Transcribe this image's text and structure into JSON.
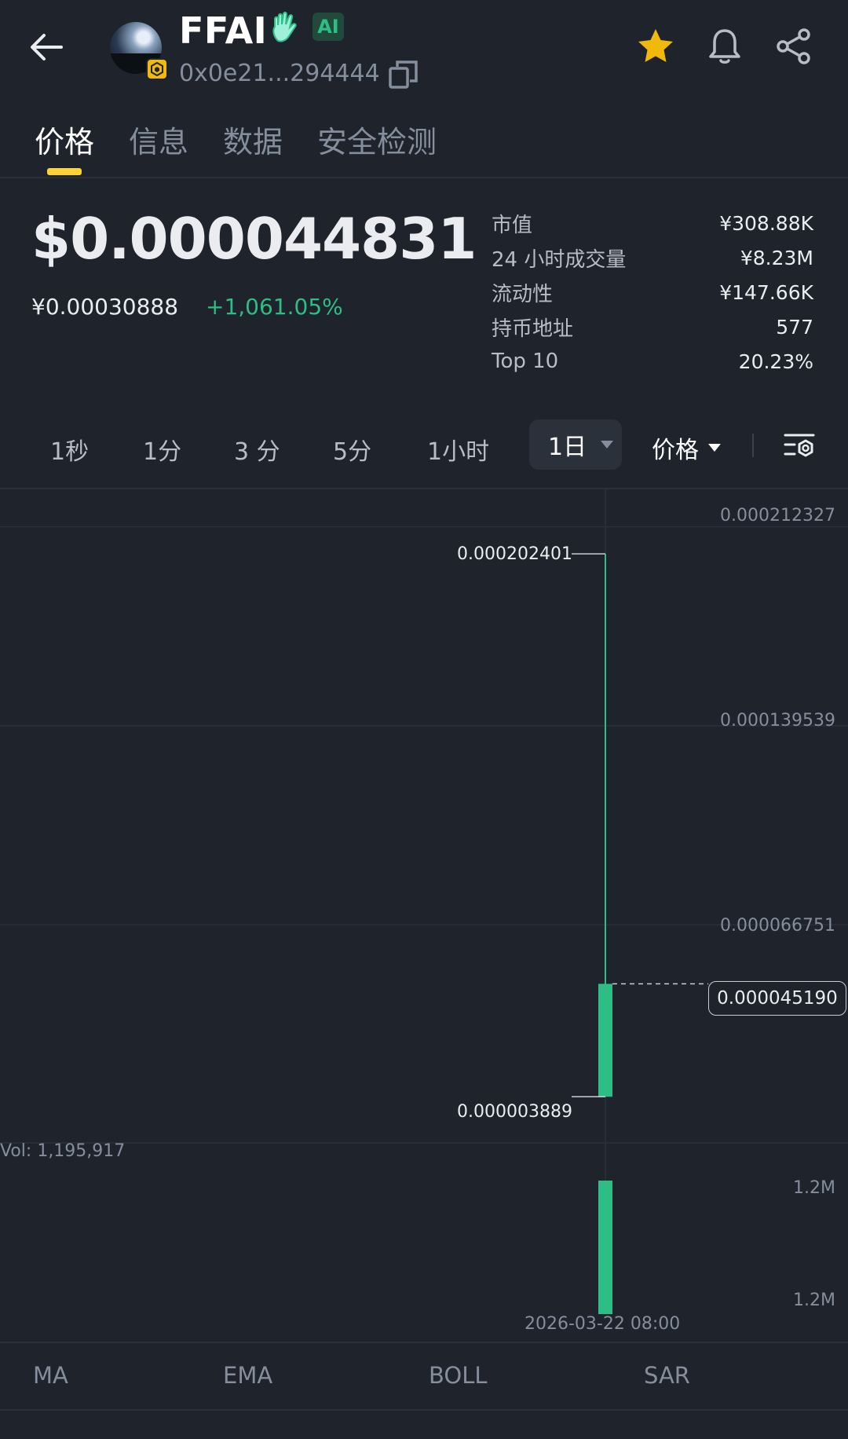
{
  "header": {
    "token_name": "FFAI",
    "ai_badge": "AI",
    "address": "0x0e21...294444"
  },
  "tabs": [
    {
      "label": "价格",
      "active": true
    },
    {
      "label": "信息",
      "active": false
    },
    {
      "label": "数据",
      "active": false
    },
    {
      "label": "安全检测",
      "active": false
    }
  ],
  "price": {
    "usd": "$0.000044831",
    "cny": "¥0.00030888",
    "change": "+1,061.05%"
  },
  "stats": [
    {
      "label": "市值",
      "value": "¥308.88K"
    },
    {
      "label": "24 小时成交量",
      "value": "¥8.23M"
    },
    {
      "label": "流动性",
      "value": "¥147.66K"
    },
    {
      "label": "持币地址",
      "value": "577"
    },
    {
      "label": "Top 10",
      "value": "20.23%"
    }
  ],
  "timeframes": [
    "1秒",
    "1分",
    "3 分",
    "5分",
    "1小时"
  ],
  "selected_timeframe": "1日",
  "chart_type_select": "价格",
  "colors": {
    "background": "#1e232c",
    "up": "#2ebd85",
    "accent": "#fcd535",
    "star": "#f0b90b"
  },
  "icons": [
    "back-arrow-icon",
    "bsc-chain-icon",
    "hand-icon",
    "copy-icon",
    "star-icon",
    "bell-icon",
    "share-icon",
    "dropdown-caret-icon",
    "chart-settings-icon"
  ],
  "chart_data": {
    "type": "candlestick",
    "candles": [
      {
        "time": "2026-03-22 08:00",
        "open": 3.889e-06,
        "high": 0.000202401,
        "low": 3.889e-06,
        "close": 4.519e-05,
        "volume": 1195917
      }
    ],
    "y_ticks": [
      "0.000212327",
      "0.000139539",
      "0.000066751"
    ],
    "ylim": [
      -1.24e-05,
      0.000226
    ],
    "high_label": "0.000202401",
    "low_label": "0.000003889",
    "current_price_label": "0.000045190",
    "volume_label": "Vol: 1,195,917",
    "volume_ticks": [
      "1.2M",
      "1.2M"
    ],
    "x_label": "2026-03-22 08:00",
    "grid": true
  },
  "indicators": [
    "MA",
    "EMA",
    "BOLL",
    "SAR"
  ]
}
